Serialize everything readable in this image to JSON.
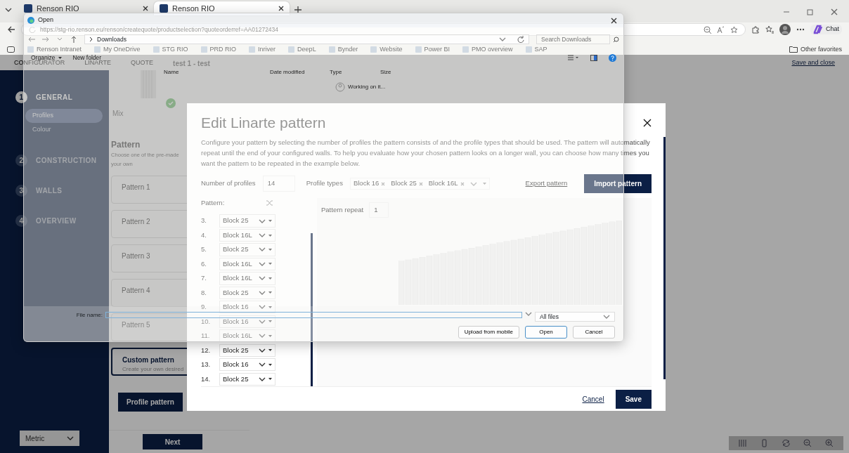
{
  "browser": {
    "tabs": [
      {
        "title": "Renson RIO",
        "selected": false
      },
      {
        "title": "Renson RIO",
        "selected": true
      }
    ],
    "address": "https://stg-rio.renson.eu/renson/createquote/productselection?quoteorderref=AA01272434",
    "favorites": [
      "Renson Intranet",
      "My OneDrive",
      "STG RIO",
      "PRD RIO",
      "Inriver",
      "DeepL",
      "Bynder",
      "Website",
      "Power BI",
      "PMO overview",
      "SAP"
    ],
    "other_favorites": "Other favorites",
    "chat": "Chat"
  },
  "app": {
    "breadcrumb": [
      "CONFIGURATOR",
      "LINARTE",
      "QUOTE"
    ],
    "quote_name": "test 1 - test",
    "save_close": "Save and close",
    "steps": [
      {
        "number": "1",
        "label": "GENERAL",
        "selected": true,
        "children": [
          {
            "label": "Profiles",
            "selected": true
          },
          {
            "label": "Colour",
            "selected": false
          }
        ]
      },
      {
        "number": "2",
        "label": "CONSTRUCTION",
        "selected": false
      },
      {
        "number": "3",
        "label": "WALLS",
        "selected": false
      },
      {
        "number": "4",
        "label": "OVERVIEW",
        "selected": false
      }
    ],
    "profile_option": "Mix",
    "pattern_title": "Pattern",
    "pattern_hint_lines": [
      "Choose one of the pre-made",
      "your own"
    ],
    "pattern_cards": [
      {
        "title": "Pattern 1",
        "selected": false
      },
      {
        "title": "Pattern 2",
        "selected": false
      },
      {
        "title": "Pattern 3",
        "selected": false
      },
      {
        "title": "Pattern 4",
        "selected": false
      },
      {
        "title": "Pattern 5",
        "selected": false
      },
      {
        "title": "Custom pattern",
        "subtitle": "Create your own desired",
        "selected": true
      }
    ],
    "profile_pattern_button": "Profile pattern",
    "units": "Metric",
    "next": "Next"
  },
  "modal": {
    "title": "Edit Linarte pattern",
    "description": "Configure your pattern by selecting the number of profiles the pattern consists of and the profile types that should be used. The pattern will automatically repeat until the end of your configured walls. To help you evaluate how your chosen pattern looks on a longer wall, you can choose how many times you want the pattern to be repeated in the example below.",
    "number_label": "Number of profiles",
    "number_value": "14",
    "types_label": "Profile types",
    "profile_types": [
      "Block 16",
      "Block 25",
      "Block 16L"
    ],
    "export": "Export pattern",
    "import": "Import pattern",
    "pattern_label": "Pattern:",
    "repeat_label": "Pattern repeat",
    "repeat_value": "1",
    "pattern": [
      {
        "number": "3.",
        "value": "Block 25"
      },
      {
        "number": "4.",
        "value": "Block 16L"
      },
      {
        "number": "5.",
        "value": "Block 25"
      },
      {
        "number": "6.",
        "value": "Block 16L"
      },
      {
        "number": "7.",
        "value": "Block 16L"
      },
      {
        "number": "8.",
        "value": "Block 25"
      },
      {
        "number": "9.",
        "value": "Block 16"
      },
      {
        "number": "10.",
        "value": "Block 16"
      },
      {
        "number": "11.",
        "value": "Block 16L"
      },
      {
        "number": "12.",
        "value": "Block 25"
      },
      {
        "number": "13.",
        "value": "Block 16"
      },
      {
        "number": "14.",
        "value": "Block 25"
      }
    ],
    "cancel": "Cancel",
    "save": "Save"
  },
  "file_dialog": {
    "title": "Open",
    "folder": "Downloads",
    "search_placeholder": "Search Downloads",
    "toolbar": [
      "Organize",
      "New folder"
    ],
    "columns": [
      "Name",
      "Date modified",
      "Type",
      "Size"
    ],
    "status": "Working on it...",
    "file_name_label": "File name:",
    "file_type": "All files",
    "buttons": [
      {
        "label": "Upload from mobile",
        "kind": "plain"
      },
      {
        "label": "Open",
        "kind": "default"
      },
      {
        "label": "Cancel",
        "kind": "plain"
      }
    ]
  }
}
